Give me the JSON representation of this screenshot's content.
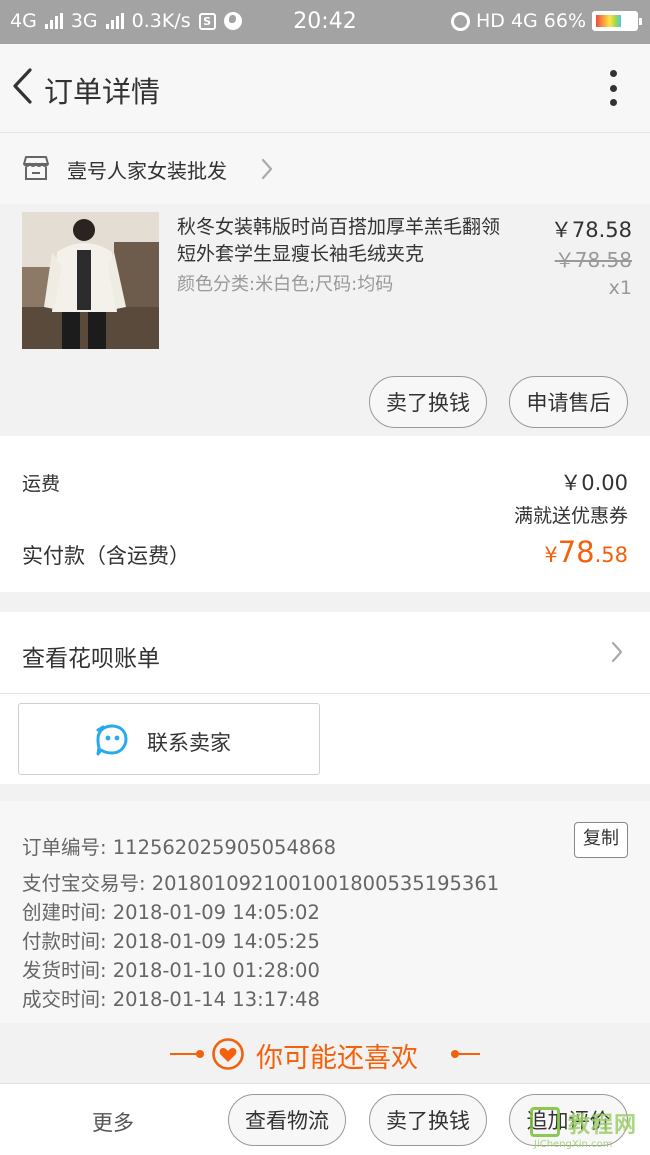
{
  "status_bar": {
    "sim1": "4G",
    "sim2": "3G",
    "speed": "0.3K/s",
    "s_badge": "S",
    "time": "20:42",
    "network": "HD 4G",
    "battery": "66%",
    "battery_level": 0.66
  },
  "header": {
    "title": "订单详情",
    "back_icon": "chevron-left-icon",
    "more_icon": "more-vertical-icon"
  },
  "shop": {
    "name": "壹号人家女装批发",
    "icon": "store-icon"
  },
  "product": {
    "title": "秋冬女装韩版时尚百搭加厚羊羔毛翻领短外套学生显瘦长袖毛绒夹克",
    "sku": "颜色分类:米白色;尺码:均码",
    "price": "￥78.58",
    "original_price": "￥78.58",
    "quantity": "x1",
    "buttons": [
      "卖了换钱",
      "申请售后"
    ]
  },
  "fees": {
    "shipping_label": "运费",
    "shipping_value": "￥0.00",
    "coupon_text": "满就送优惠券",
    "paid_label": "实付款（含运费）",
    "paid_currency": "¥",
    "paid_integer": "78",
    "paid_decimal": ".58"
  },
  "huabei": {
    "label": "查看花呗账单"
  },
  "contact": {
    "label": "联系卖家",
    "icon": "chat-bubble-icon"
  },
  "order_info": {
    "copy_label": "复制",
    "lines": [
      "订单编号: 112562025905054868",
      "支付宝交易号: 2018010921001001800535195361",
      "创建时间: 2018-01-09 14:05:02",
      "付款时间: 2018-01-09 14:05:25",
      "发货时间: 2018-01-10 01:28:00",
      "成交时间: 2018-01-14 13:17:48"
    ]
  },
  "recommend": {
    "title": "你可能还喜欢",
    "icon": "heart-icon"
  },
  "bottom_bar": {
    "more": "更多",
    "buttons": [
      "查看物流",
      "卖了换钱",
      "追加评价"
    ]
  },
  "watermark": {
    "text": "教程网",
    "url": "JiChengXin.com"
  },
  "colors": {
    "accent": "#f5600a",
    "status_bar_bg": "#a3a3a3",
    "contact_icon": "#29a9f0"
  }
}
